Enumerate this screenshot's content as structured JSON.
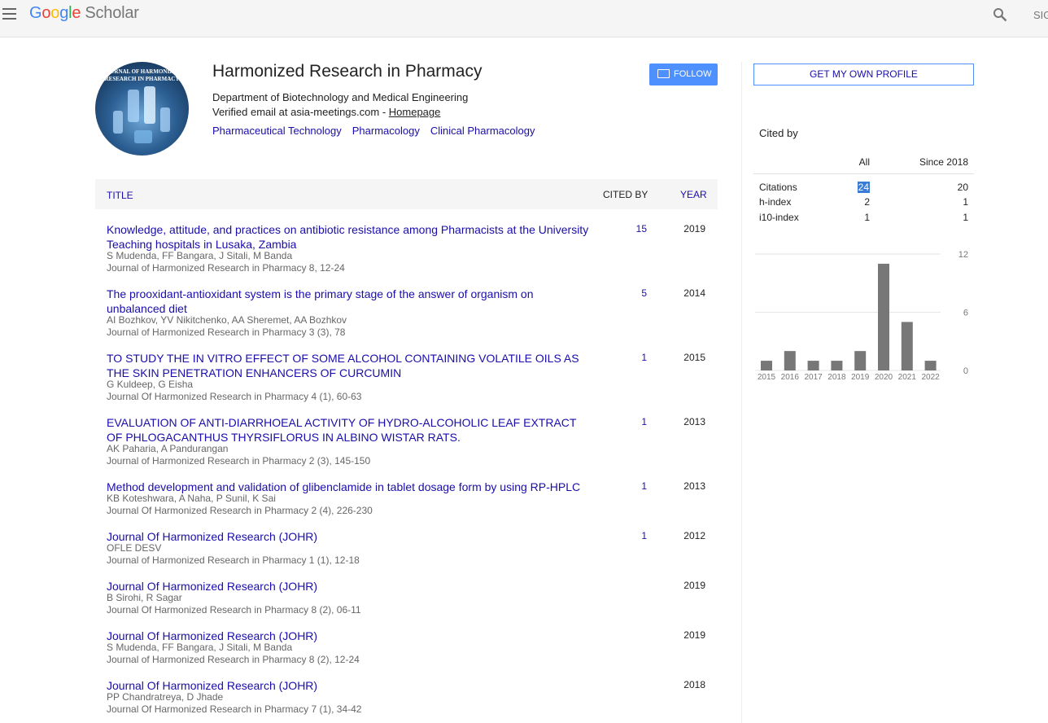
{
  "topbar": {
    "logo_google": [
      "G",
      "o",
      "o",
      "g",
      "l",
      "e"
    ],
    "logo_scholar": "Scholar",
    "signin": "SIG"
  },
  "profile": {
    "avatar_text": "JOURNAL OF HARMONIZED RESEARCH IN PHARMACY",
    "name": "Harmonized Research in Pharmacy",
    "affiliation": "Department of Biotechnology and Medical Engineering",
    "email_text": "Verified email at asia-meetings.com - ",
    "homepage_label": "Homepage",
    "interests": [
      "Pharmaceutical Technology",
      "Pharmacology",
      "Clinical Pharmacology"
    ],
    "follow_label": "FOLLOW",
    "own_profile_label": "GET MY OWN PROFILE"
  },
  "table": {
    "col_title": "TITLE",
    "col_cited": "CITED BY",
    "col_year": "YEAR",
    "rows": [
      {
        "title": "Knowledge, attitude, and practices on antibiotic resistance among Pharmacists at the University Teaching hospitals in Lusaka, Zambia",
        "authors": "S Mudenda, FF Bangara, J Sitali, M Banda",
        "venue": "Journal of Harmonized Research in Pharmacy 8, 12-24",
        "cited": "15",
        "year": "2019",
        "lines": 2
      },
      {
        "title": "The prooxidant-antioxidant system is the primary stage of the answer of organism on unbalanced diet",
        "authors": "AI Bozhkov, YV Nikitchenko, AA Sheremet, AA Bozhkov",
        "venue": "Journal of Harmonized Research in Pharmacy 3 (3), 78",
        "cited": "5",
        "year": "2014",
        "lines": 2
      },
      {
        "title": "TO STUDY THE IN VITRO EFFECT OF SOME ALCOHOL CONTAINING VOLATILE OILS AS THE SKIN PENETRATION ENHANCERS OF CURCUMIN",
        "authors": "G Kuldeep, G Eisha",
        "venue": "Journal Of Harmonized Research in Pharmacy 4 (1), 60-63",
        "cited": "1",
        "year": "2015",
        "lines": 2
      },
      {
        "title": "EVALUATION OF ANTI-DIARRHOEAL ACTIVITY OF HYDRO-ALCOHOLIC LEAF EXTRACT OF PHLOGACANTHUS THYRSIFLORUS IN ALBINO WISTAR RATS.",
        "authors": "AK Paharia, A Pandurangan",
        "venue": "Journal of Harmonized Research in Pharmacy 2 (3), 145-150",
        "cited": "1",
        "year": "2013",
        "lines": 2
      },
      {
        "title": "Method development and validation of glibenclamide in tablet dosage form by using RP-HPLC",
        "authors": "KB Koteshwara, A Naha, P Sunil, K Sai",
        "venue": "Journal Of Harmonized Research in Pharmacy 2 (4), 226-230",
        "cited": "1",
        "year": "2013",
        "lines": 1
      },
      {
        "title": "Journal Of Harmonized Research (JOHR)",
        "authors": "OFLE DESV",
        "venue": "Journal of Harmonized Research in Pharmacy 1 (1), 12-18",
        "cited": "1",
        "year": "2012",
        "lines": 1
      },
      {
        "title": "Journal Of Harmonized Research (JOHR)",
        "authors": "B Sirohi, R Sagar",
        "venue": "Journal Of Harmonized Research in Pharmacy 8 (2), 06-11",
        "cited": "",
        "year": "2019",
        "lines": 1
      },
      {
        "title": "Journal Of Harmonized Research (JOHR)",
        "authors": "S Mudenda, FF Bangara, J Sitali, M Banda",
        "venue": "Journal of Harmonized Research in Pharmacy 8 (2), 12-24",
        "cited": "",
        "year": "2019",
        "lines": 1
      },
      {
        "title": "Journal Of Harmonized Research (JOHR)",
        "authors": "PP Chandratreya, D Jhade",
        "venue": "Journal Of Harmonized Research in Pharmacy 7 (1), 34-42",
        "cited": "",
        "year": "2018",
        "lines": 1
      }
    ]
  },
  "cited_by": {
    "label": "Cited by",
    "col_all": "All",
    "col_since": "Since 2018",
    "rows": [
      {
        "label": "Citations",
        "all": "24",
        "since": "20"
      },
      {
        "label": "h-index",
        "all": "2",
        "since": "1"
      },
      {
        "label": "i10-index",
        "all": "1",
        "since": "1"
      }
    ]
  },
  "chart_data": {
    "type": "bar",
    "categories": [
      "2015",
      "2016",
      "2017",
      "2018",
      "2019",
      "2020",
      "2021",
      "2022"
    ],
    "values": [
      1,
      2,
      1,
      1,
      2,
      11,
      5,
      1
    ],
    "yticks": [
      "0",
      "6",
      "12"
    ],
    "ylim": [
      0,
      12
    ],
    "bar_color": "#777777",
    "grid": true
  }
}
